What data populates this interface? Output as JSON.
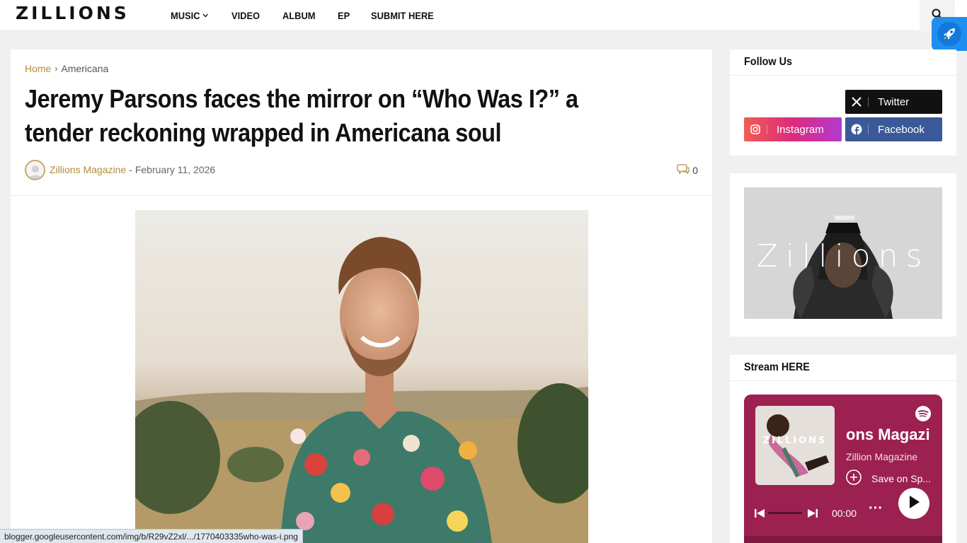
{
  "header": {
    "logo": "ZILLIONS",
    "nav": [
      {
        "label": "MUSIC",
        "has_dropdown": true
      },
      {
        "label": "VIDEO"
      },
      {
        "label": "ALBUM"
      },
      {
        "label": "EP"
      },
      {
        "label": "SUBMIT HERE"
      }
    ],
    "search_icon": "search-icon",
    "rocket_icon": "rocket-icon"
  },
  "article": {
    "breadcrumb": {
      "home": "Home",
      "separator": "›",
      "current": "Americana"
    },
    "title": "Jeremy Parsons faces the mirror on “Who Was I?” a tender reckoning wrapped in Americana soul",
    "author": "Zillions Magazine",
    "dash": "-",
    "date": "February 11, 2026",
    "comment_count": "0"
  },
  "sidebar": {
    "follow": {
      "title": "Follow Us",
      "links": [
        {
          "label": "Twitter",
          "icon": "x-twitter-icon",
          "color": "#111111"
        },
        {
          "label": "Instagram",
          "icon": "instagram-icon",
          "color": "#e1306c"
        },
        {
          "label": "Facebook",
          "icon": "facebook-icon",
          "color": "#3b5998"
        }
      ]
    },
    "banner": {
      "text": "Zillions"
    },
    "stream": {
      "title": "Stream HERE",
      "player": {
        "cover_text": "ZILLIONS",
        "playlist_title": "ons Magazi",
        "owner": "Zillion Magazine",
        "save_label": "Save on Sp...",
        "time": "00:00",
        "more": "···",
        "bg_color": "#9c2150"
      }
    }
  },
  "statusbar": {
    "url": "blogger.googleusercontent.com/img/b/R29vZ2xl/.../1770403335who-was-i.png"
  }
}
